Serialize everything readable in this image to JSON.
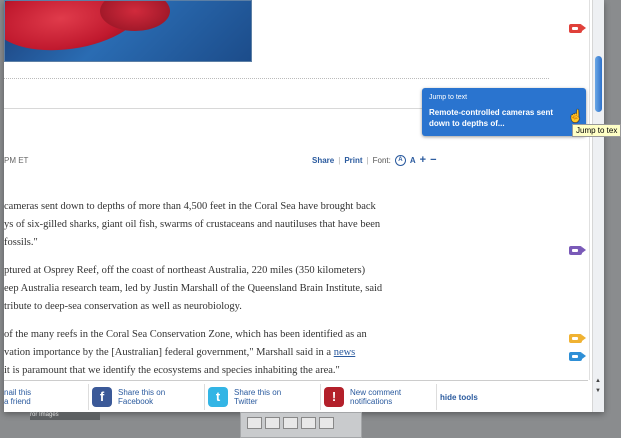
{
  "byline": {
    "time": "PM ET"
  },
  "tools": {
    "share": "Share",
    "print": "Print",
    "font": "Font:",
    "aa": "A",
    "a": "A",
    "plus": "+",
    "minus": "−"
  },
  "article": {
    "p1": [
      "cameras sent down to depths of more than 4,500 feet in the Coral Sea have brought back",
      "ys of six-gilled sharks, giant oil fish, swarms of crustaceans and nautiluses that have been",
      " fossils.\""
    ],
    "p2": [
      "ptured at Osprey Reef, off the coast of northeast Australia, 220 miles (350 kilometers)",
      "eep Australia research team, led by Justin Marshall of the Queensland Brain Institute, said",
      "tribute to deep-sea conservation as well as neurobiology."
    ],
    "p3": {
      "line1": "of the many reefs in the Coral Sea Conservation Zone, which has been identified as an",
      "line2_prefix": "vation importance by the [Australian] federal government,\" Marshall said in a ",
      "line2_link": "news",
      "line3": " it is paramount that we identify the ecosystems and species inhabiting the area.\""
    }
  },
  "jump_tooltip": {
    "heading": "Jump to text",
    "body": "Remote-controlled cameras sent down to depths of..."
  },
  "hover_tooltip": "Jump to tex",
  "share_bar": {
    "friend": {
      "line1": "nail this",
      "line2": "a friend"
    },
    "facebook": {
      "icon": "f",
      "line1": "Share this on",
      "line2": "Facebook"
    },
    "twitter": {
      "icon": "t",
      "line1": "Share this on",
      "line2": "Twitter"
    },
    "notify": {
      "icon": "!",
      "line1": "New comment",
      "line2": "notifications"
    },
    "hide": "hide tools"
  },
  "under_window_text": "ror Images",
  "colors": {
    "tooltip_bg": "#2a74cf",
    "link": "#2a5a9e",
    "marker_red": "#e0403a",
    "marker_purple": "#7a5ab8",
    "marker_yellow": "#f0b232",
    "marker_blue": "#2e8fd6"
  }
}
